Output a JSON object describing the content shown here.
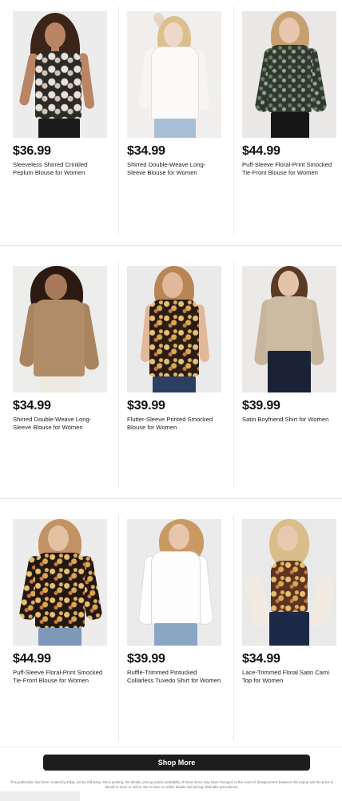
{
  "products": [
    {
      "price": "$36.99",
      "name": "Sleeveless Shirred Crinkled Peplum Blouse for Women"
    },
    {
      "price": "$34.99",
      "name": "Shirred Double-Weave Long-Sleeve Blouse for Women"
    },
    {
      "price": "$44.99",
      "name": "Puff-Sleeve Floral-Print Smocked Tie-Front Blouse for Women"
    },
    {
      "price": "$34.99",
      "name": "Shirred Double-Weave Long-Sleeve Blouse for Women"
    },
    {
      "price": "$39.99",
      "name": "Flutter-Sleeve Printed Smocked Blouse for Women"
    },
    {
      "price": "$39.99",
      "name": "Satin Boyfriend Shirt for Women"
    },
    {
      "price": "$44.99",
      "name": "Puff-Sleeve Floral-Print Smocked Tie-Front Blouse for Women"
    },
    {
      "price": "$39.99",
      "name": "Ruffle-Trimmed Pintucked Collarless Tuxedo Shirt for Women"
    },
    {
      "price": "$34.99",
      "name": "Lace-Trimmed Floral Satin Cami Top for Women"
    }
  ],
  "shop_more_label": "Shop More",
  "disclaimer": "This publication has been created by Flipp, not by Old Navy. Since posting, the details, pricing and/or availability of these items may have changed. In the event of disagreement between this popup and the price or details in-store or online, the in-store or online details and pricing shall take precedence."
}
